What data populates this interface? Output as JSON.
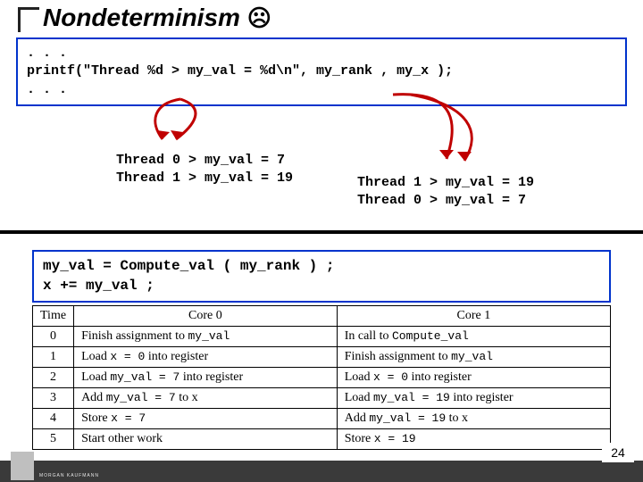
{
  "title_text": "Nondeterminism",
  "title_emoji": "☹",
  "code1_l1": ". . .",
  "code1_l2": "printf(\"Thread %d > my_val = %d\\n\", my_rank , my_x );",
  "code1_l3": ". . .",
  "out_left_l1": "Thread 0 > my_val = 7",
  "out_left_l2": "Thread 1 > my_val = 19",
  "out_right_l1": "Thread 1 > my_val = 19",
  "out_right_l2": "Thread 0 > my_val = 7",
  "code2_l1": "my_val = Compute_val ( my_rank ) ;",
  "code2_l2": "x += my_val ;",
  "table": {
    "headers": [
      "Time",
      "Core 0",
      "Core 1"
    ],
    "rows": [
      {
        "t": "0",
        "c0_pre": "Finish assignment to ",
        "c0_mono": "my_val",
        "c0_post": "",
        "c1_pre": "In call to ",
        "c1_mono": "Compute_val",
        "c1_post": ""
      },
      {
        "t": "1",
        "c0_pre": "Load ",
        "c0_mono": "x = 0",
        "c0_post": " into register",
        "c1_pre": "Finish assignment to ",
        "c1_mono": "my_val",
        "c1_post": ""
      },
      {
        "t": "2",
        "c0_pre": "Load ",
        "c0_mono": "my_val = 7",
        "c0_post": " into register",
        "c1_pre": "Load ",
        "c1_mono": "x = 0",
        "c1_post": " into register"
      },
      {
        "t": "3",
        "c0_pre": "Add ",
        "c0_mono": "my_val = 7",
        "c0_post": " to x",
        "c1_pre": "Load ",
        "c1_mono": "my_val = 19",
        "c1_post": " into register"
      },
      {
        "t": "4",
        "c0_pre": "Store ",
        "c0_mono": "x = 7",
        "c0_post": "",
        "c1_pre": "Add ",
        "c1_mono": "my_val = 19",
        "c1_post": " to x"
      },
      {
        "t": "5",
        "c0_pre": "Start other work",
        "c0_mono": "",
        "c0_post": "",
        "c1_pre": "Store ",
        "c1_mono": "x = 19",
        "c1_post": ""
      }
    ]
  },
  "page_number": "24",
  "footer_text": "MORGAN KAUFMANN"
}
